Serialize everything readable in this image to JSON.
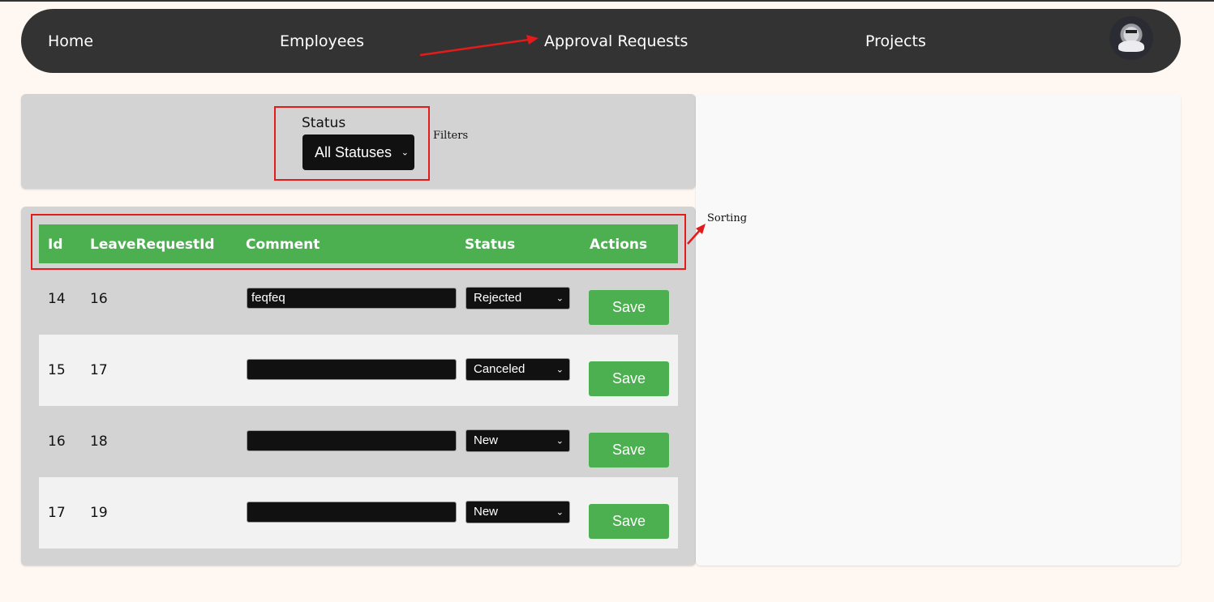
{
  "nav": {
    "items": [
      "Home",
      "Employees",
      "Approval Requests",
      "Projects"
    ]
  },
  "filters": {
    "status_label": "Status",
    "status_selected": "All Statuses"
  },
  "table": {
    "headers": [
      "Id",
      "LeaveRequestId",
      "Comment",
      "Status",
      "Actions"
    ],
    "rows": [
      {
        "id": "14",
        "leave_request_id": "16",
        "comment": "feqfeq",
        "status": "Rejected",
        "action": "Save"
      },
      {
        "id": "15",
        "leave_request_id": "17",
        "comment": "",
        "status": "Canceled",
        "action": "Save"
      },
      {
        "id": "16",
        "leave_request_id": "18",
        "comment": "",
        "status": "New",
        "action": "Save"
      },
      {
        "id": "17",
        "leave_request_id": "19",
        "comment": "",
        "status": "New",
        "action": "Save"
      }
    ]
  },
  "annotations": {
    "filters": "Filters",
    "sorting": "Sorting",
    "color": "#e31b1b"
  },
  "colors": {
    "nav_bg": "#333333",
    "accent_green": "#4caf50",
    "panel_gray": "#d3d3d3",
    "page_bg": "#fff8f2"
  }
}
